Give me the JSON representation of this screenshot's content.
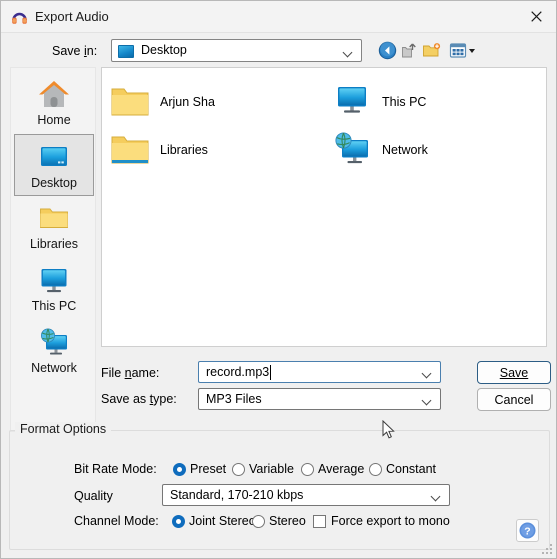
{
  "window": {
    "title": "Export Audio",
    "app_icon": "audacity-headphones-icon",
    "close_icon": "close-icon"
  },
  "toolbar": {
    "save_in_label": "Save in:",
    "save_in_value": "Desktop",
    "buttons": [
      {
        "name": "back-button",
        "icon": "back-arrow-icon"
      },
      {
        "name": "up-one-level-button",
        "icon": "up-folder-icon"
      },
      {
        "name": "create-new-folder-button",
        "icon": "new-folder-icon"
      },
      {
        "name": "views-button",
        "icon": "views-grid-icon"
      }
    ]
  },
  "places": [
    {
      "label": "Home",
      "icon": "home-icon",
      "selected": false
    },
    {
      "label": "Desktop",
      "icon": "desktop-icon",
      "selected": true
    },
    {
      "label": "Libraries",
      "icon": "folder-icon",
      "selected": false
    },
    {
      "label": "This PC",
      "icon": "monitor-icon",
      "selected": false
    },
    {
      "label": "Network",
      "icon": "network-icon",
      "selected": false
    }
  ],
  "files": [
    {
      "label": "Arjun Sha",
      "icon": "folder-icon"
    },
    {
      "label": "Libraries",
      "icon": "folder-icon"
    },
    {
      "label": "This PC",
      "icon": "monitor-icon"
    },
    {
      "label": "Network",
      "icon": "network-icon"
    }
  ],
  "form": {
    "file_name_label": "File name:",
    "file_name_label_pre": "File ",
    "file_name_label_underline": "n",
    "file_name_label_post": "ame:",
    "file_name_value": "record.mp3",
    "save_as_type_label": "Save as type:",
    "save_as_type_label_pre": "Save as ",
    "save_as_type_label_underline": "t",
    "save_as_type_label_post": "ype:",
    "save_as_type_value": "MP3 Files",
    "save_button": "Save",
    "save_button_pre": "",
    "save_button_underline": "S",
    "save_button_post": "ave",
    "cancel_button": "Cancel"
  },
  "format_options": {
    "legend": "Format Options",
    "bit_rate_mode_label": "Bit Rate Mode:",
    "bit_rate_modes": [
      {
        "label": "Preset",
        "selected": true
      },
      {
        "label": "Variable",
        "selected": false
      },
      {
        "label": "Average",
        "selected": false
      },
      {
        "label": "Constant",
        "selected": false
      }
    ],
    "quality_label": "Quality",
    "quality_value": "Standard, 170-210 kbps",
    "channel_mode_label": "Channel Mode:",
    "channel_modes": [
      {
        "label": "Joint Stereo",
        "selected": true
      },
      {
        "label": "Stereo",
        "selected": false
      }
    ],
    "force_mono_label": "Force export to mono",
    "force_mono_checked": false,
    "help_icon": "help-question-icon"
  },
  "colors": {
    "accent": "#0f6cbd",
    "dialog_bg": "#f0f0f0",
    "panel_bg": "#ffffff",
    "sidebar_bg": "#f3f3f3",
    "default_button_border": "#2c5d85"
  }
}
